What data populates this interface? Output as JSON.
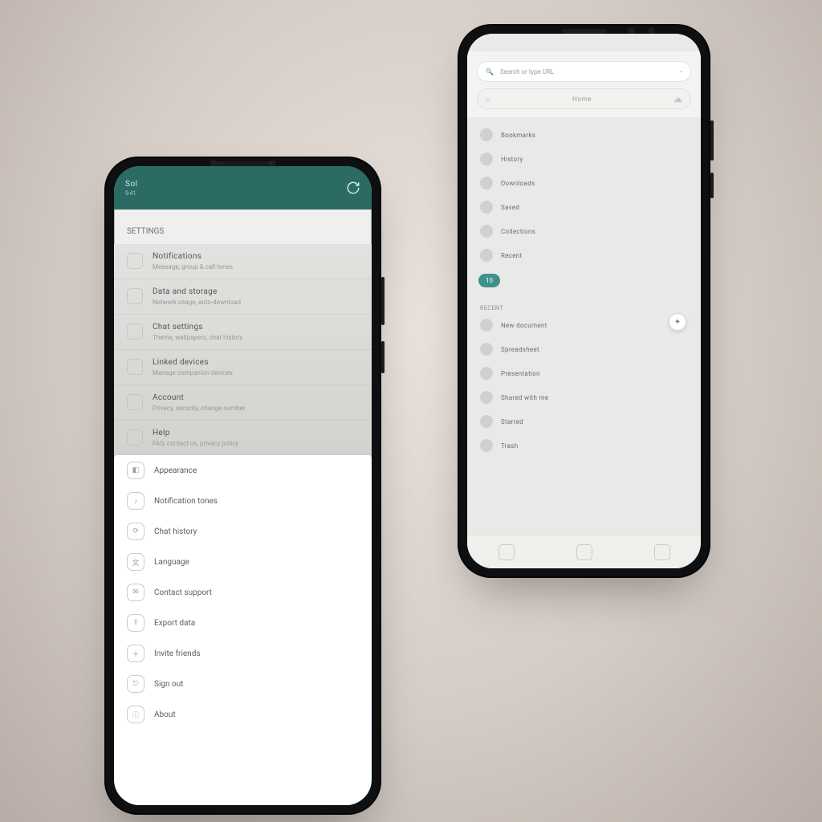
{
  "colors": {
    "accent": "#2b6b64",
    "pill": "#3f918a"
  },
  "leftPhone": {
    "header": {
      "title": "Sol",
      "time": "9:41",
      "action_icon": "sync-icon"
    },
    "section_label": "SETTINGS",
    "items": [
      {
        "title": "Notifications",
        "sub": "Message, group & call tones"
      },
      {
        "title": "Data and storage",
        "sub": "Network usage, auto-download"
      },
      {
        "title": "Chat settings",
        "sub": "Theme, wallpapers, chat history"
      },
      {
        "title": "Linked devices",
        "sub": "Manage companion devices"
      },
      {
        "title": "Account",
        "sub": "Privacy, security, change number"
      },
      {
        "title": "Help",
        "sub": "FAQ, contact us, privacy policy"
      }
    ],
    "sheet": [
      {
        "label": "Appearance"
      },
      {
        "label": "Notification tones"
      },
      {
        "label": "Chat history"
      },
      {
        "label": "Language"
      },
      {
        "label": "Contact support"
      },
      {
        "label": "Export data"
      },
      {
        "label": "Invite friends"
      },
      {
        "label": "Sign out"
      },
      {
        "label": "About"
      }
    ]
  },
  "rightPhone": {
    "search": {
      "placeholder": "Search or type URL"
    },
    "chip": {
      "label": "Home"
    },
    "group1": [
      {
        "label": "Bookmarks"
      },
      {
        "label": "History"
      },
      {
        "label": "Downloads"
      },
      {
        "label": "Saved"
      },
      {
        "label": "Collections"
      },
      {
        "label": "Recent"
      }
    ],
    "pill": "10",
    "heading": "RECENT",
    "group2": [
      {
        "label": "New document"
      },
      {
        "label": "Spreadsheet"
      },
      {
        "label": "Presentation"
      },
      {
        "label": "Shared with me"
      },
      {
        "label": "Starred"
      },
      {
        "label": "Trash"
      }
    ],
    "tabs": [
      "home-icon",
      "tabs-icon",
      "share-icon"
    ]
  }
}
